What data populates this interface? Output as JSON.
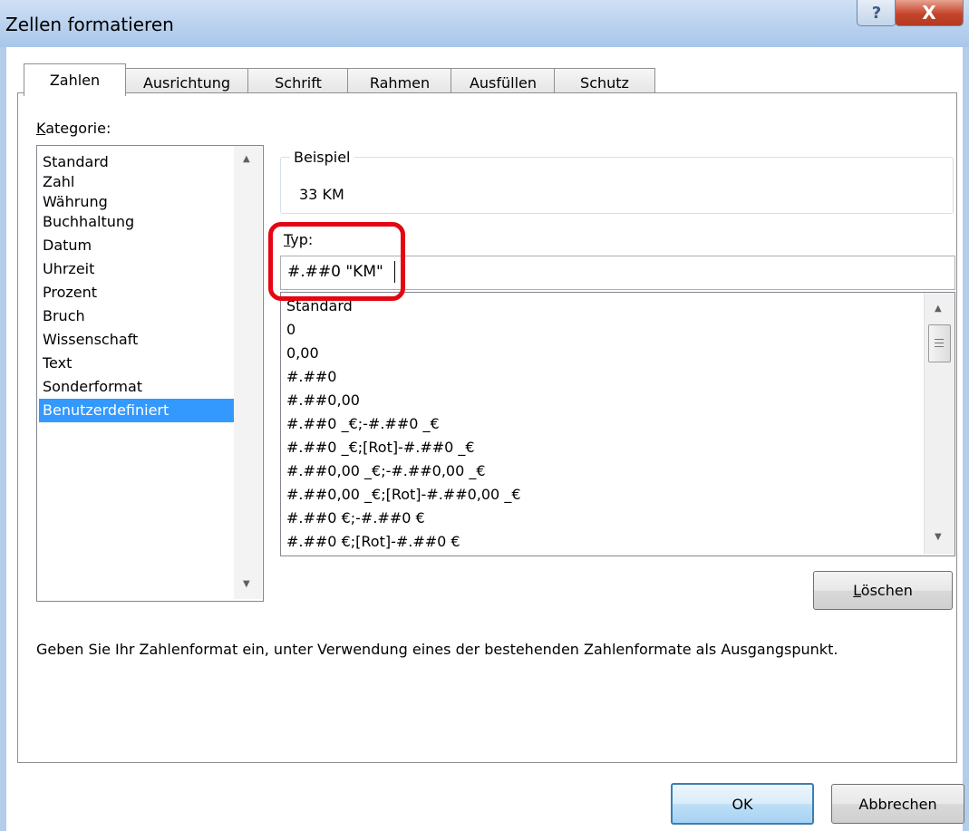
{
  "window": {
    "title": "Zellen formatieren",
    "help_glyph": "?",
    "close_glyph": "X"
  },
  "tabs": [
    "Zahlen",
    "Ausrichtung",
    "Schrift",
    "Rahmen",
    "Ausfüllen",
    "Schutz"
  ],
  "category": {
    "label_first": "K",
    "label_rest": "ategorie:",
    "items": [
      "Standard",
      "Zahl",
      "Währung",
      "Buchhaltung",
      "Datum",
      "Uhrzeit",
      "Prozent",
      "Bruch",
      "Wissenschaft",
      "Text",
      "Sonderformat",
      "Benutzerdefiniert"
    ],
    "selected": "Benutzerdefiniert"
  },
  "sample": {
    "legend": "Beispiel",
    "value": "33 KM"
  },
  "type": {
    "label_first": "T",
    "label_rest": "yp:",
    "value": "#.##0 \"KM\""
  },
  "formats": [
    "Standard",
    "0",
    "0,00",
    "#.##0",
    "#.##0,00",
    "#.##0 _€;-#.##0 _€",
    "#.##0 _€;[Rot]-#.##0 _€",
    "#.##0,00 _€;-#.##0,00 _€",
    "#.##0,00 _€;[Rot]-#.##0,00 _€",
    "#.##0 €;-#.##0 €",
    "#.##0 €;[Rot]-#.##0 €"
  ],
  "delete_button": {
    "label_first": "L",
    "label_rest": "öschen"
  },
  "help_text": "Geben Sie Ihr Zahlenformat ein, unter Verwendung eines der bestehenden Zahlenformate als Ausgangspunkt.",
  "buttons": {
    "ok": "OK",
    "cancel": "Abbrechen"
  },
  "icons": {
    "scroll_up": "scroll-up-arrow",
    "scroll_down": "scroll-down-arrow"
  },
  "colors": {
    "selection": "#3399ff",
    "highlight": "#e30613",
    "titlebar": "#b9d1ee"
  }
}
